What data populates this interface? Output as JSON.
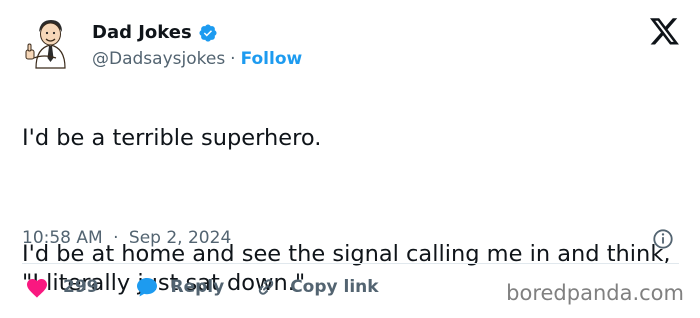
{
  "author": {
    "name": "Dad Jokes",
    "handle": "@Dadsaysjokes",
    "separator": "·",
    "follow_label": "Follow",
    "verified": true
  },
  "tweet": {
    "line1": "I'd be a terrible superhero.",
    "line2": "I'd be at home and see the signal calling me in and think, \"I literally just sat down.\"",
    "time": "10:58 AM",
    "separator": "·",
    "date": "Sep 2, 2024"
  },
  "actions": {
    "like_count": "299",
    "reply_label": "Reply",
    "copy_label": "Copy link"
  },
  "watermark": "boredpanda.com",
  "icons": {
    "avatar": "dad-cartoon-avatar-icon",
    "verified": "verified-badge-icon",
    "brand": "x-logo-icon",
    "info": "info-icon",
    "like": "heart-icon",
    "reply": "speech-bubble-icon",
    "copy": "link-icon"
  },
  "colors": {
    "text": "#0f1419",
    "secondary": "#536471",
    "accent": "#1d9bf0",
    "like": "#f91880",
    "reply": "#1d9bf0"
  }
}
